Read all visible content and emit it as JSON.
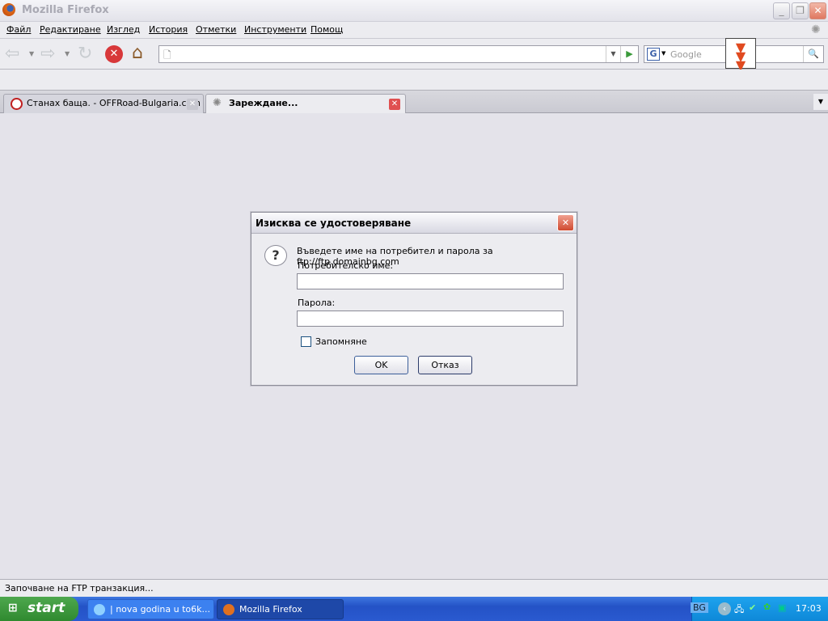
{
  "window": {
    "title": "Mozilla Firefox"
  },
  "menu": [
    "Файл",
    "Редактиране",
    "Изглед",
    "История",
    "Отметки",
    "Инструменти",
    "Помощ"
  ],
  "search": {
    "placeholder": "Google"
  },
  "tabs": [
    {
      "label": "Станах баща. - OFFRoad-Bulgaria.com"
    },
    {
      "label": "Зареждане..."
    }
  ],
  "dialog": {
    "title": "Изисква се удостоверяване",
    "message": "Въведете име на потребител и парола за ftp://ftp.domainbg.com",
    "username_label": "Потребителско име:",
    "username_value": "",
    "password_label": "Парола:",
    "password_value": "",
    "remember_label": "Запомняне",
    "remember_checked": false,
    "ok": "OK",
    "cancel": "Отказ"
  },
  "status": "Започване на FTP транзакция...",
  "taskbar": {
    "start": "start",
    "items": [
      "| nova godina u to6k...",
      "Mozilla Firefox"
    ],
    "lang": "BG",
    "clock": "17:03"
  }
}
